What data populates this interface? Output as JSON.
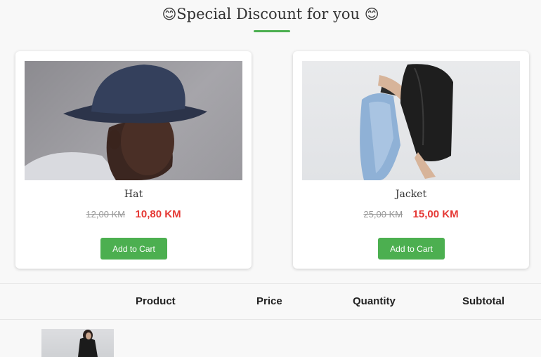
{
  "header": {
    "emoji_left": "😊",
    "title": "Special Discount for you",
    "emoji_right": "😊",
    "accent_color": "#4caf50"
  },
  "discount_products": [
    {
      "name": "Hat",
      "old_price": "12,00 KM",
      "new_price": "10,80 KM",
      "button_label": "Add to Cart",
      "image": "man-in-bucket-hat-photo"
    },
    {
      "name": "Jacket",
      "old_price": "25,00 KM",
      "new_price": "15,00 KM",
      "button_label": "Add to Cart",
      "image": "person-in-jeans-and-jacket-photo"
    }
  ],
  "cart_table": {
    "columns": [
      "",
      "Product",
      "Price",
      "Quantity",
      "Subtotal"
    ],
    "rows": [
      {
        "image": "product-thumbnail-photo"
      }
    ]
  },
  "colors": {
    "sale_price": "#e53935",
    "button": "#4caf50",
    "old_price": "#999999"
  }
}
